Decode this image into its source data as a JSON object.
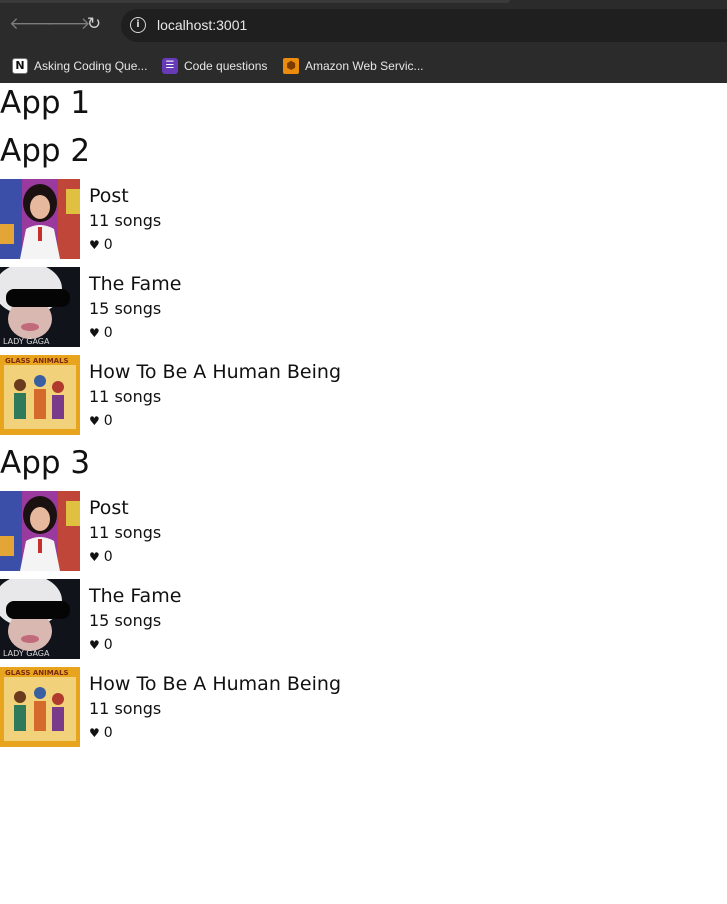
{
  "browser": {
    "url": "localhost:3001",
    "bookmarks": [
      {
        "label": "Asking Coding Que...",
        "icon": "notion-icon",
        "glyph": "N"
      },
      {
        "label": "Code questions",
        "icon": "list-icon",
        "glyph": "☰"
      },
      {
        "label": "Amazon Web Servic...",
        "icon": "aws-cube-icon",
        "glyph": "⬢"
      }
    ]
  },
  "apps": [
    {
      "title": "App 1",
      "albums": []
    },
    {
      "title": "App 2",
      "albums": [
        {
          "title": "Post",
          "songs": "11 songs",
          "likes": "0",
          "cover": "post-cover"
        },
        {
          "title": "The Fame",
          "songs": "15 songs",
          "likes": "0",
          "cover": "fame-cover"
        },
        {
          "title": "How To Be A Human Being",
          "songs": "11 songs",
          "likes": "0",
          "cover": "human-being-cover"
        }
      ]
    },
    {
      "title": "App 3",
      "albums": [
        {
          "title": "Post",
          "songs": "11 songs",
          "likes": "0",
          "cover": "post-cover"
        },
        {
          "title": "The Fame",
          "songs": "15 songs",
          "likes": "0",
          "cover": "fame-cover"
        },
        {
          "title": "How To Be A Human Being",
          "songs": "11 songs",
          "likes": "0",
          "cover": "human-being-cover"
        }
      ]
    }
  ],
  "cover_text": {
    "fame": "LADY GAGA",
    "human_being": "GLASS ANIMALS"
  },
  "heart_glyph": "♥"
}
